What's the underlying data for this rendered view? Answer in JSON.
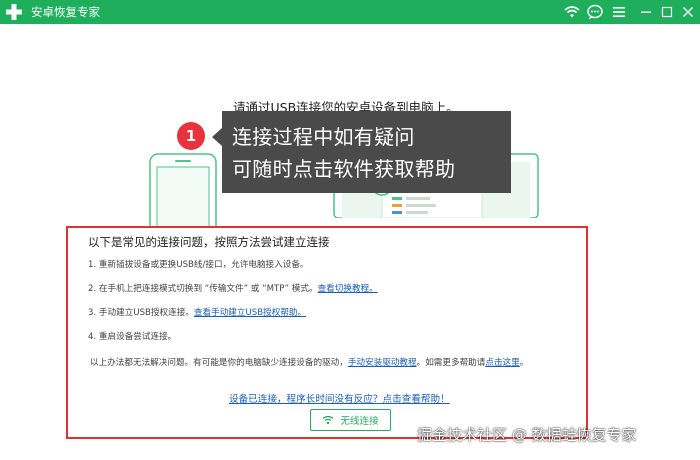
{
  "app": {
    "title": "安卓恢复专家"
  },
  "colors": {
    "titlebar": "#1fae5b",
    "tooltip_bg": "#4a4a4a",
    "badge": "#e8333c",
    "panel_border": "#e0322f",
    "link": "#1a5fb4",
    "accent_green": "#2aa864"
  },
  "icons": {
    "logo": "plus-cross-icon",
    "wifi": "wifi-icon",
    "chat": "chat-icon",
    "menu": "menu-icon",
    "minimize": "minimize-icon",
    "maximize": "maximize-icon",
    "close": "close-icon"
  },
  "instruction": "请通过USB连接您的安卓设备到电脑上。",
  "tooltip": {
    "badge": "1",
    "line1": "连接过程中如有疑问",
    "line2": "可随时点击软件获取帮助"
  },
  "help": {
    "heading": "以下是常见的连接问题，按照方法尝试建立连接",
    "items": [
      {
        "text": "1.  重新插拔设备或更换USB线/接口，允许电脑接入设备。",
        "link": ""
      },
      {
        "text": "2.  在手机上把连接模式切换到 “传输文件” 或 “MTP” 模式。",
        "link": "查看切换教程。"
      },
      {
        "text": "3.  手动建立USB授权连接。",
        "link": "查看手动建立USB授权帮助。"
      },
      {
        "text": "4.  重启设备尝试连接。",
        "link": ""
      }
    ],
    "note": {
      "prefix": "以上办法都无法解决问题。有可能是你的电脑缺少连接设备的驱动，",
      "driver_link": "手动安装驱动教程",
      "middle": "。如需更多帮助请",
      "here_link": "点击这里",
      "suffix": "。"
    },
    "no_response_link": "设备已连接，程序长时间没有反应？点击查看帮助！",
    "wireless_button": "无线连接"
  },
  "watermark": "掘金技术社区 @ 数据蛙恢复专家"
}
